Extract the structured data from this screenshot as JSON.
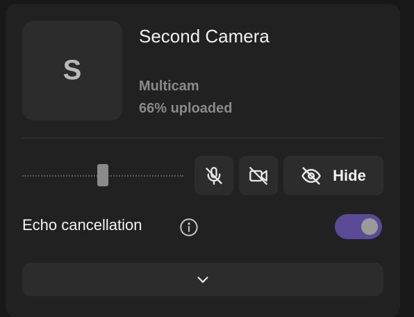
{
  "camera": {
    "avatar_letter": "S",
    "name": "Second Camera",
    "type": "Multicam",
    "upload_status": "66% uploaded",
    "upload_progress": 0.66
  },
  "controls": {
    "volume_level": 0.5,
    "mute_mic_icon": "mic-off-icon",
    "camera_off_icon": "video-off-icon",
    "hide_icon": "eye-off-icon",
    "hide_label": "Hide"
  },
  "echo": {
    "label": "Echo cancellation",
    "info_icon": "info-icon",
    "enabled": true
  },
  "footer": {
    "expand_icon": "chevron-down-icon"
  },
  "colors": {
    "background": "#181818",
    "card": "#212121",
    "surface": "#2c2c2c",
    "toggle_on": "#5b4a96",
    "text_primary": "#f2f2f2",
    "text_secondary": "#8a8a8a"
  }
}
